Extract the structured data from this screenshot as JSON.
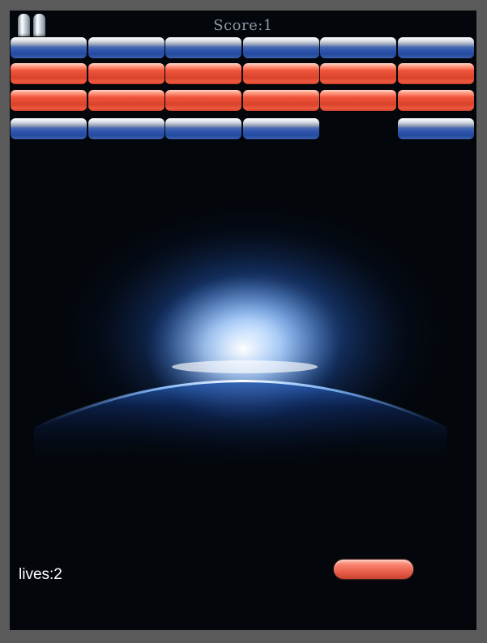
{
  "hud": {
    "score_text": "Score:1",
    "lives_text": "lives:2",
    "pause_icon": "pause-icon"
  },
  "bricks": {
    "columns": 6,
    "rows": [
      [
        "blue",
        "blue",
        "blue",
        "blue",
        "blue",
        "blue"
      ],
      [
        "red",
        "red",
        "red",
        "red",
        "red",
        "red"
      ],
      [
        "red",
        "red",
        "red",
        "red",
        "red",
        "red"
      ],
      [
        "blue",
        "blue",
        "blue",
        "blue",
        null,
        "blue"
      ]
    ]
  },
  "colors": {
    "blue_brick": "#2f55ad",
    "red_brick": "#e14a32",
    "paddle": "#f06c56",
    "background": "#03060b",
    "frame": "#5a5a5a"
  }
}
